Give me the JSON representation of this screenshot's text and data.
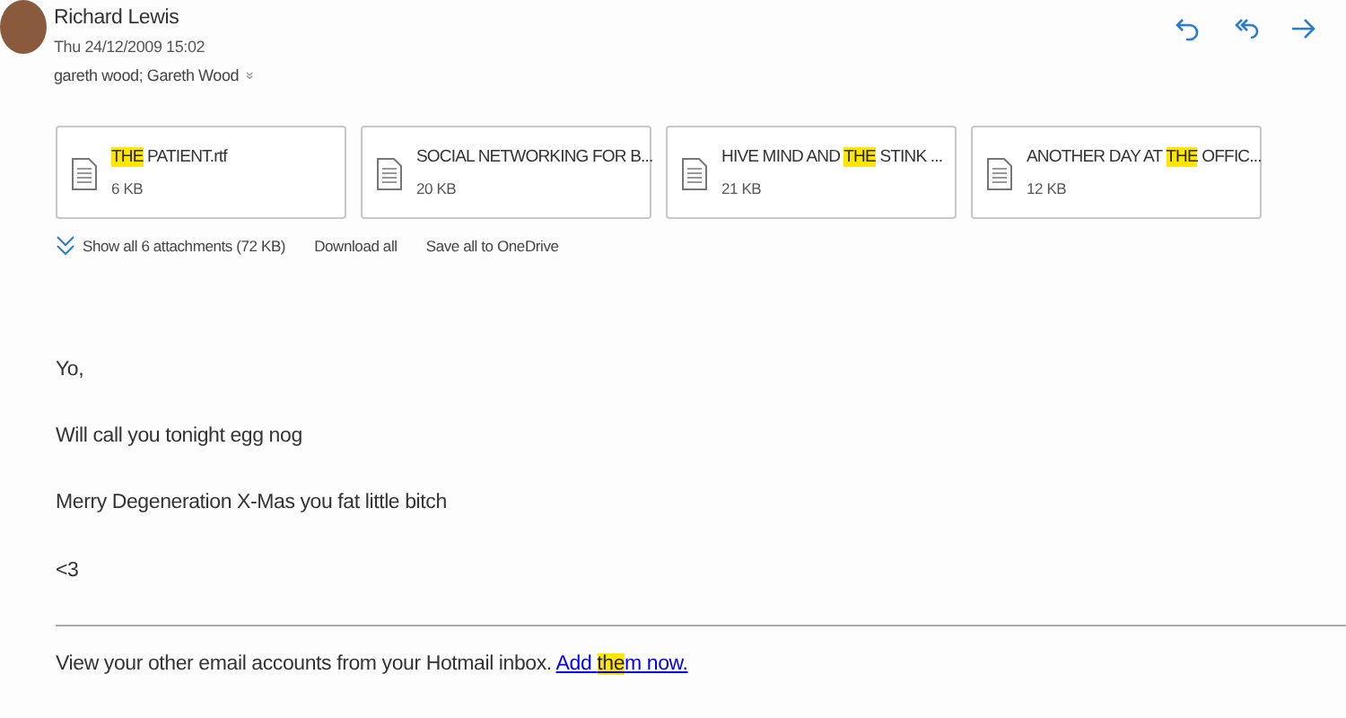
{
  "sender": {
    "name": "Richard Lewis",
    "date": "Thu 24/12/2009 15:02",
    "recipients": "gareth wood; Gareth Wood",
    "expand_icon": "»"
  },
  "attachments": [
    {
      "name": [
        {
          "text": "THE",
          "highlighted": true
        },
        {
          "text": " PATIENT.rtf",
          "highlighted": false
        }
      ],
      "size": "6 KB"
    },
    {
      "name": [
        {
          "text": "SOCIAL NETWORKING FOR B...",
          "highlighted": false
        }
      ],
      "size": "20 KB"
    },
    {
      "name": [
        {
          "text": "HIVE MIND AND ",
          "highlighted": false
        },
        {
          "text": "THE",
          "highlighted": true
        },
        {
          "text": " STINK ...",
          "highlighted": false
        }
      ],
      "size": "21 KB"
    },
    {
      "name": [
        {
          "text": "ANOTHER DAY AT ",
          "highlighted": false
        },
        {
          "text": "THE",
          "highlighted": true
        },
        {
          "text": " OFFIC...",
          "highlighted": false
        }
      ],
      "size": "12 KB"
    }
  ],
  "attachment_actions": {
    "show_all": "Show all 6 attachments (72 KB)",
    "download_all": "Download all",
    "save_all": "Save all to OneDrive"
  },
  "body": [
    "Yo,",
    "Will call you tonight egg nog",
    "Merry Degeneration X-Mas you fat little bitch",
    "<3"
  ],
  "footer": {
    "text": "View your other email accounts from your Hotmail inbox. ",
    "link": [
      {
        "text": "Add ",
        "highlighted": false
      },
      {
        "text": "the",
        "highlighted": true
      },
      {
        "text": "m now.",
        "highlighted": false
      }
    ]
  }
}
